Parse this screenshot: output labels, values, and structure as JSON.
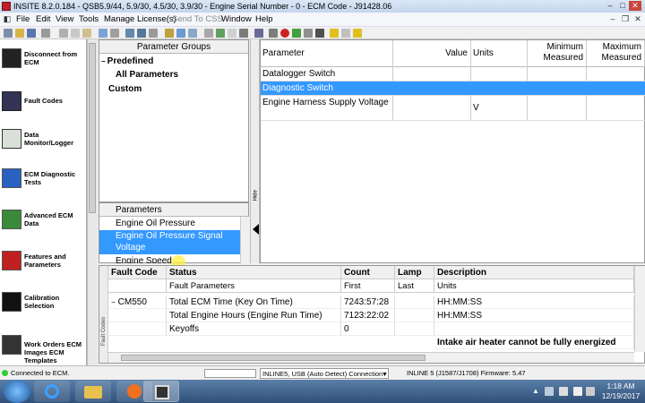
{
  "titlebar": {
    "text": "INSITE 8.2.0.184 - QSB5.9/44, 5.9/30, 4.5/30, 3.9/30 - Engine Serial Number - 0 - ECM Code - J91428.06"
  },
  "menu": {
    "items": [
      "File",
      "Edit",
      "View",
      "Tools",
      "Manage License(s)",
      "Send To CSS",
      "Window",
      "Help"
    ]
  },
  "sidebar": {
    "items": [
      {
        "label": "Disconnect from ECM",
        "icon": "disconnect-icon"
      },
      {
        "label": "Fault Codes",
        "icon": "fault-codes-icon"
      },
      {
        "label": "Data Monitor/Logger",
        "icon": "data-monitor-icon"
      },
      {
        "label": "ECM Diagnostic Tests",
        "icon": "diagnostic-tests-icon"
      },
      {
        "label": "Advanced ECM Data",
        "icon": "advanced-ecm-icon"
      },
      {
        "label": "Features and Parameters",
        "icon": "features-icon"
      },
      {
        "label": "Calibration Selection",
        "icon": "calibration-icon"
      },
      {
        "label": "Work Orders ECM Images ECM Templates",
        "icon": "work-orders-icon"
      }
    ]
  },
  "param_groups": {
    "header": "Parameter Groups",
    "predefined": "Predefined",
    "all_parameters": "All Parameters",
    "custom": "Custom"
  },
  "parameters": {
    "header": "Parameters",
    "items": [
      "Engine Oil Pressure",
      "Engine Oil Pressure Signal Voltage",
      "Engine Speed"
    ]
  },
  "hide_label": "Hide",
  "monitor_table": {
    "headers": {
      "parameter": "Parameter",
      "value": "Value",
      "units": "Units",
      "min": "Minimum Measured",
      "max": "Maximum Measured"
    },
    "rows": [
      {
        "parameter": "Datalogger Switch",
        "value": "",
        "units": ""
      },
      {
        "parameter": "Diagnostic Switch",
        "value": "",
        "units": ""
      },
      {
        "parameter": "Engine Harness Supply Voltage",
        "value": "",
        "units": "V"
      }
    ]
  },
  "fault_table": {
    "side_label": "Fault Codes",
    "headers": {
      "fault_code": "Fault Code",
      "status": "Status",
      "count": "Count",
      "lamp": "Lamp",
      "description": "Description"
    },
    "subheaders": {
      "params": "Fault Parameters",
      "first": "First",
      "last": "Last",
      "units": "Units"
    },
    "code": "CM550",
    "rows": [
      {
        "param": "Total ECM Time (Key On Time)",
        "first": "7243:57:28",
        "last": "",
        "units": "HH:MM:SS"
      },
      {
        "param": "Total Engine Hours (Engine Run Time)",
        "first": "7123:22:02",
        "last": "",
        "units": "HH:MM:SS"
      },
      {
        "param": "Keyoffs",
        "first": "0",
        "last": "",
        "units": ""
      }
    ],
    "description": "Intake air heater cannot be fully energized"
  },
  "status": {
    "connection": "Connected to ECM.",
    "adapter": "INLINE5, USB (Auto Detect) Connection",
    "firmware": "INLINE 5 (J1587/J1708) Firmware: 5.47"
  },
  "clock": {
    "time": "1:18 AM",
    "date": "12/19/2017"
  }
}
